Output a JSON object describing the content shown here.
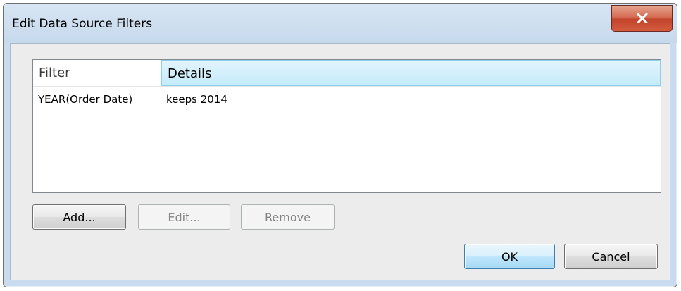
{
  "dialog": {
    "title": "Edit Data Source Filters",
    "close_icon": "close-icon"
  },
  "table": {
    "columns": [
      "Filter",
      "Details"
    ],
    "rows": [
      {
        "filter": "YEAR(Order Date)",
        "details": "keeps 2014"
      }
    ]
  },
  "buttons": {
    "add": "Add...",
    "edit": "Edit...",
    "remove": "Remove",
    "ok": "OK",
    "cancel": "Cancel"
  },
  "colors": {
    "dialog_frame": "#c9dcef",
    "close_button": "#c2432a",
    "header_highlight": "#c4ebfa",
    "default_button": "#a7d9f5"
  }
}
